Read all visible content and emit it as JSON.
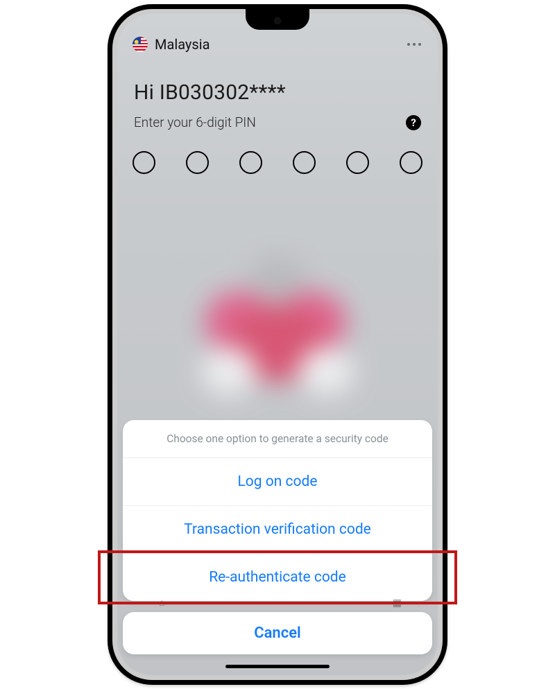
{
  "header": {
    "country_label": "Malaysia"
  },
  "greeting": "Hi IB030302****",
  "pin_prompt": "Enter your 6-digit PIN",
  "pin_length": 6,
  "sheet": {
    "title": "Choose one option to generate a security code",
    "items": [
      "Log on code",
      "Transaction verification code",
      "Re-authenticate code"
    ],
    "highlight_index": 2,
    "cancel_label": "Cancel"
  },
  "colors": {
    "action_blue": "#147bff",
    "callout_red": "#c01818"
  }
}
